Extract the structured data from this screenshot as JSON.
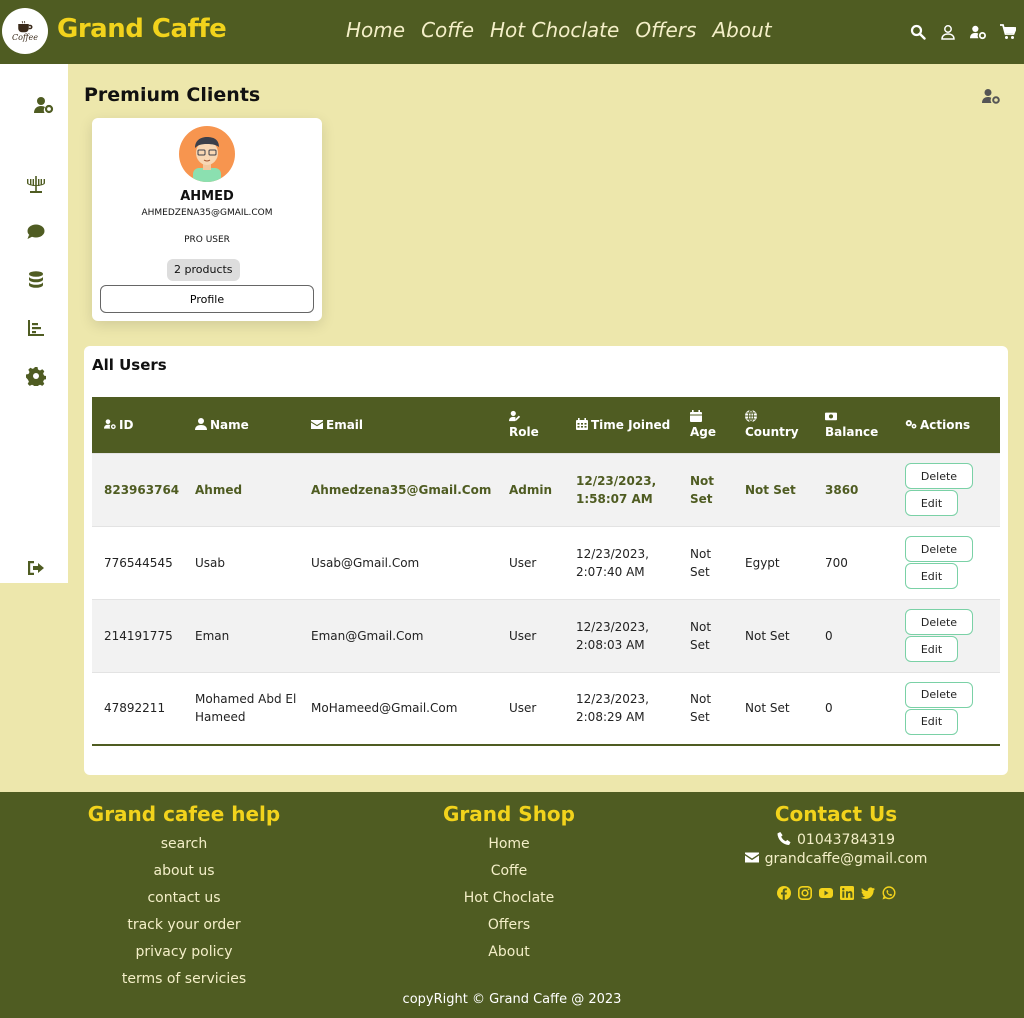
{
  "navbar": {
    "logo_text": "Coffee",
    "brand": "Grand Caffe",
    "links": [
      "Home",
      "Coffe",
      "Hot Choclate",
      "Offers",
      "About"
    ],
    "icons": [
      "search-icon",
      "user-icon",
      "user-gear-icon",
      "cart-icon"
    ]
  },
  "sidebar": {
    "icons": [
      "user-gear-icon",
      "menorah-icon",
      "comment-icon",
      "database-icon",
      "chart-bar-icon",
      "gear-icon",
      "sign-out-icon"
    ]
  },
  "page": {
    "title": "Premium Clients"
  },
  "client_card": {
    "name": "AHMED",
    "email": "AHMEDZENA35@GMAIL.COM",
    "role": "PRO USER",
    "products": "2 products",
    "profile_button": "Profile"
  },
  "users": {
    "title": "All Users",
    "columns": [
      "ID",
      "Name",
      "Email",
      "Role",
      "Time Joined",
      "Age",
      "Country",
      "Balance",
      "Actions"
    ],
    "delete_label": "Delete",
    "edit_label": "Edit",
    "rows": [
      {
        "id": "823963764",
        "name": "Ahmed",
        "email": "Ahmedzena35@Gmail.Com",
        "role": "Admin",
        "time_joined": "12/23/2023, 1:58:07 AM",
        "age": "Not Set",
        "country": "Not Set",
        "balance": "3860"
      },
      {
        "id": "776544545",
        "name": "Usab",
        "email": "Usab@Gmail.Com",
        "role": "User",
        "time_joined": "12/23/2023, 2:07:40 AM",
        "age": "Not Set",
        "country": "Egypt",
        "balance": "700"
      },
      {
        "id": "214191775",
        "name": "Eman",
        "email": "Eman@Gmail.Com",
        "role": "User",
        "time_joined": "12/23/2023, 2:08:03 AM",
        "age": "Not Set",
        "country": "Not Set",
        "balance": "0"
      },
      {
        "id": "47892211",
        "name": "Mohamed Abd El Hameed",
        "email": "MoHameed@Gmail.Com",
        "role": "User",
        "time_joined": "12/23/2023, 2:08:29 AM",
        "age": "Not Set",
        "country": "Not Set",
        "balance": "0"
      }
    ]
  },
  "footer": {
    "help": {
      "title": "Grand cafee help",
      "links": [
        "search",
        "about us",
        "contact us",
        "track your order",
        "privacy policy",
        "terms of servicies"
      ]
    },
    "shop": {
      "title": "Grand Shop",
      "links": [
        "Home",
        "Coffe",
        "Hot Choclate",
        "Offers",
        "About"
      ]
    },
    "contact": {
      "title": "Contact Us",
      "phone": "01043784319",
      "email": "grandcaffe@gmail.com",
      "socials": [
        "facebook-icon",
        "instagram-icon",
        "youtube-icon",
        "linkedin-icon",
        "twitter-icon",
        "whatsapp-icon"
      ]
    },
    "copyright": "copyRight © Grand Caffe @ 2023"
  },
  "colors": {
    "primary": "#4f5c22",
    "accent": "#f2d31c",
    "background": "#ede7ac",
    "button_border": "#7ad1a6"
  }
}
